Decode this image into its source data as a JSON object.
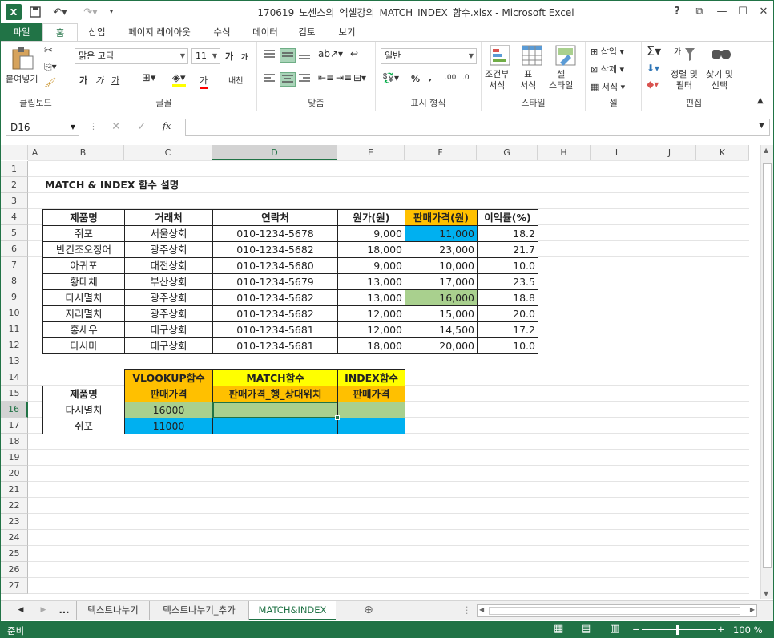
{
  "app": {
    "title": "170619_노센스의_엑셀강의_MATCH_INDEX_함수.xlsx - Microsoft Excel",
    "logo": "X"
  },
  "window_controls": {
    "help": "?",
    "restore_ribbon": "⧉",
    "minimize": "—",
    "maximize": "☐",
    "close": "✕"
  },
  "ribbon_tabs": [
    "파일",
    "홈",
    "삽입",
    "페이지 레이아웃",
    "수식",
    "데이터",
    "검토",
    "보기"
  ],
  "ribbon": {
    "clipboard": {
      "label": "클립보드",
      "paste": "붙여넣기"
    },
    "font": {
      "label": "글꼴",
      "name": "맑은 고딕",
      "size": "11",
      "grow": "가",
      "shrink": "가",
      "bold": "가",
      "italic": "가",
      "underline": "가",
      "color_a": "가",
      "phonetic": "내천"
    },
    "align": {
      "label": "맞춤"
    },
    "number": {
      "label": "표시 형식",
      "format": "일반",
      "percent": "%",
      "comma": ",",
      "inc_dec": ".00",
      "dec_dec": ".0"
    },
    "styles": {
      "label": "스타일",
      "cond": "조건부\n서식",
      "table": "표\n서식",
      "cell": "셀\n스타일"
    },
    "cells": {
      "label": "셀",
      "insert": "삽입",
      "delete": "삭제",
      "format": "서식"
    },
    "editing": {
      "label": "편집",
      "sort": "정렬 및\n필터",
      "find": "찾기 및\n선택"
    }
  },
  "formula_bar": {
    "name_box": "D16",
    "fx": "fx",
    "value": ""
  },
  "columns": [
    "A",
    "B",
    "C",
    "D",
    "E",
    "F",
    "G",
    "H",
    "I",
    "J",
    "K"
  ],
  "rows": [
    "1",
    "2",
    "3",
    "4",
    "5",
    "6",
    "7",
    "8",
    "9",
    "10",
    "11",
    "12",
    "13",
    "14",
    "15",
    "16",
    "17",
    "18",
    "19",
    "20",
    "21",
    "22",
    "23",
    "24",
    "25",
    "26",
    "27"
  ],
  "sheet": {
    "title": "MATCH & INDEX 함수 설명",
    "headers": [
      "제품명",
      "거래처",
      "연락처",
      "원가(원)",
      "판매가격(원)",
      "이익률(%)"
    ],
    "data": [
      [
        "쥐포",
        "서울상회",
        "010-1234-5678",
        "9,000",
        "11,000",
        "18.2"
      ],
      [
        "반건조오징어",
        "광주상회",
        "010-1234-5682",
        "18,000",
        "23,000",
        "21.7"
      ],
      [
        "아귀포",
        "대전상회",
        "010-1234-5680",
        "9,000",
        "10,000",
        "10.0"
      ],
      [
        "황태채",
        "부산상회",
        "010-1234-5679",
        "13,000",
        "17,000",
        "23.5"
      ],
      [
        "다시멸치",
        "광주상회",
        "010-1234-5682",
        "13,000",
        "16,000",
        "18.8"
      ],
      [
        "지리멸치",
        "광주상회",
        "010-1234-5682",
        "12,000",
        "15,000",
        "20.0"
      ],
      [
        "홍새우",
        "대구상회",
        "010-1234-5681",
        "12,000",
        "14,500",
        "17.2"
      ],
      [
        "다시마",
        "대구상회",
        "010-1234-5681",
        "18,000",
        "20,000",
        "10.0"
      ]
    ],
    "lookup": {
      "fn_headers": [
        "VLOOKUP함수",
        "MATCH함수",
        "INDEX함수"
      ],
      "sub_headers": [
        "제품명",
        "판매가격",
        "판매가격_행_상대위치",
        "판매가격"
      ],
      "rows": [
        [
          "다시멸치",
          "16000",
          "",
          ""
        ],
        [
          "쥐포",
          "11000",
          "",
          ""
        ]
      ]
    }
  },
  "sheet_tabs": [
    "...",
    "텍스트나누기",
    "텍스트나누기_추가",
    "MATCH&INDEX"
  ],
  "status": {
    "ready": "준비",
    "zoom": "100 %"
  },
  "colors": {
    "excel_green": "#217346",
    "orange": "#FFC000",
    "yellow": "#FFFF00",
    "blue": "#00B0F0",
    "green": "#A9D08E"
  }
}
